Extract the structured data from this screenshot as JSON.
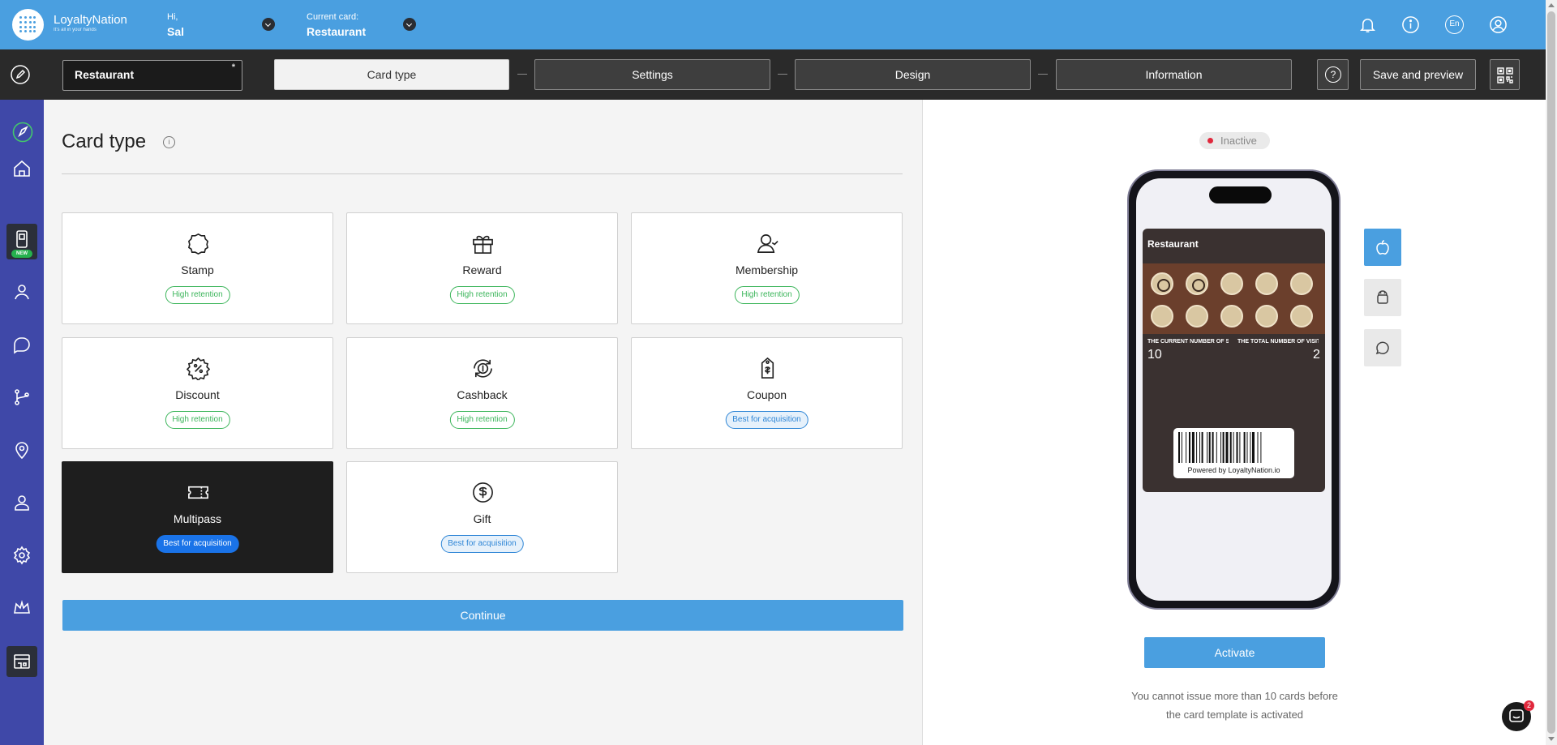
{
  "header": {
    "brand": "LoyaltyNation",
    "brand_tagline": "It's all in your hands",
    "greeting": "Hi,",
    "user_name": "Sal",
    "current_card_label": "Current card:",
    "current_card_name": "Restaurant",
    "language": "En"
  },
  "toolbar": {
    "card_name_value": "Restaurant",
    "required_mark": "*",
    "steps": [
      {
        "label": "Card type"
      },
      {
        "label": "Settings"
      },
      {
        "label": "Design"
      },
      {
        "label": "Information"
      }
    ],
    "help_label": "?",
    "save_label": "Save and preview"
  },
  "sidebar": {
    "new_badge": "NEW"
  },
  "main": {
    "title": "Card type",
    "info_label": "i",
    "tiles": [
      {
        "label": "Stamp",
        "badge": "High retention"
      },
      {
        "label": "Reward",
        "badge": "High retention"
      },
      {
        "label": "Membership",
        "badge": "High retention"
      },
      {
        "label": "Discount",
        "badge": "High retention"
      },
      {
        "label": "Cashback",
        "badge": "High retention"
      },
      {
        "label": "Coupon",
        "badge": "Best for acquisition"
      },
      {
        "label": "Multipass",
        "badge": "Best for acquisition",
        "selected": true
      },
      {
        "label": "Gift",
        "badge": "Best for acquisition"
      }
    ],
    "continue_label": "Continue"
  },
  "preview": {
    "status": "Inactive",
    "pass": {
      "title": "Restaurant",
      "field1_label": "THE CURRENT NUMBER OF STAMPS",
      "field1_value": "10",
      "field2_label": "THE TOTAL NUMBER OF VISITS",
      "field2_value": "2",
      "stamps_total": 10,
      "stamps_filled": 2,
      "powered_by": "Powered by LoyaltyNation.io"
    },
    "activate_label": "Activate",
    "warning_line1": "You cannot issue more than 10 cards before",
    "warning_line2": "the card template is activated"
  },
  "chat": {
    "unread": "2"
  },
  "colors": {
    "brand_blue": "#4a9fe0",
    "sidebar": "#3f48a8",
    "toolbar": "#2a2a2a",
    "retention_green": "#3bb55a",
    "acquisition_blue": "#2f86d6",
    "inactive_red": "#e0283c"
  }
}
